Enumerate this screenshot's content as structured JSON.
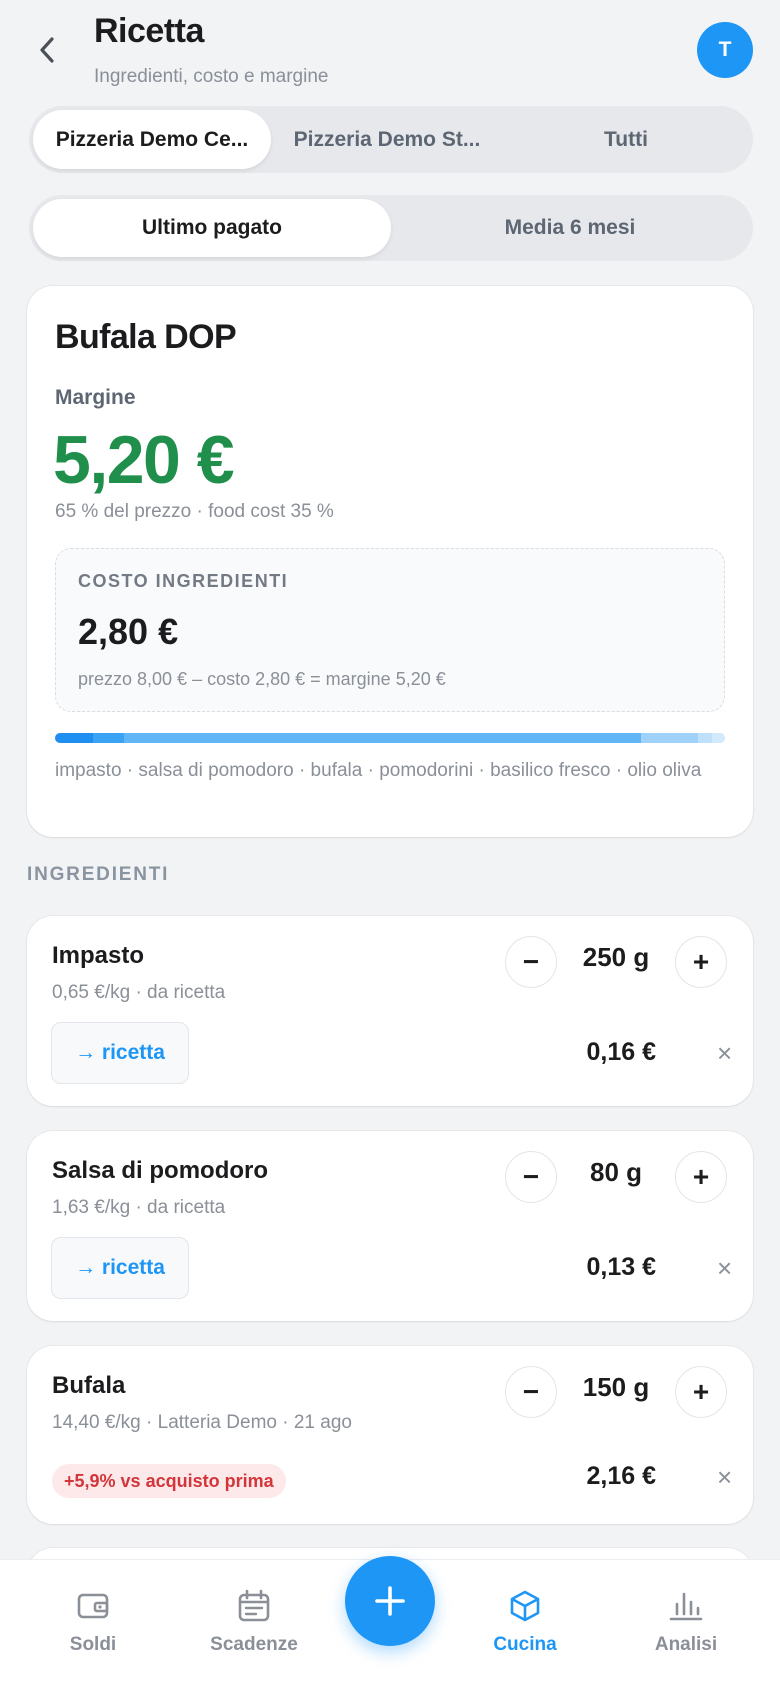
{
  "header": {
    "title": "Ricetta",
    "subtitle": "Ingredienti, costo e margine",
    "avatar_initial": "T"
  },
  "locations": {
    "tabs": [
      "Pizzeria Demo Ce...",
      "Pizzeria Demo St...",
      "Tutti"
    ],
    "selected": "Pizzeria Demo Ce..."
  },
  "price_mode": {
    "tabs": [
      "Ultimo pagato",
      "Media 6 mesi"
    ],
    "selected": "Ultimo pagato"
  },
  "summary": {
    "recipe_name": "Bufala DOP",
    "margin_label": "Margine",
    "margin_value": "5,20 €",
    "margin_sub": "65 % del prezzo · food cost 35 %",
    "cost_label": "COSTO INGREDIENTI",
    "cost_value": "2,80 €",
    "cost_formula": "prezzo 8,00 € – costo 2,80 € = margine 5,20 €",
    "cost_breakdown": [
      {
        "name": "impasto",
        "share": 0.057,
        "color": "#1e8ff0"
      },
      {
        "name": "salsa di pomodoro",
        "share": 0.046,
        "color": "#3aa3f4"
      },
      {
        "name": "bufala",
        "share": 0.771,
        "color": "#60b6f7"
      },
      {
        "name": "pomodorini",
        "share": 0.086,
        "color": "#9fd2fa"
      },
      {
        "name": "basilico fresco",
        "share": 0.02,
        "color": "#bfe0fb"
      },
      {
        "name": "olio oliva",
        "share": 0.02,
        "color": "#d3eafc"
      }
    ],
    "ingredients_text": "impasto · salsa di pomodoro · bufala · pomodorini · basilico fresco · olio oliva"
  },
  "ingredients_section": {
    "label": "INGREDIENTI",
    "items": [
      {
        "name": "Impasto",
        "meta": "0,65 €/kg · da ricetta",
        "qty": "250 g",
        "price": "0,16 €",
        "link": "→ ricetta"
      },
      {
        "name": "Salsa di pomodoro",
        "meta": "1,63 €/kg · da ricetta",
        "qty": "80 g",
        "price": "0,13 €",
        "link": "→ ricetta"
      },
      {
        "name": "Bufala",
        "meta": "14,40 €/kg · Latteria Demo · 21 ago",
        "qty": "150 g",
        "price": "2,16 €",
        "badge": "+5,9% vs acquisto prima"
      }
    ],
    "minus": "−",
    "plus": "+",
    "remove": "×"
  },
  "nav": {
    "items": [
      {
        "label": "Soldi",
        "icon": "wallet-icon"
      },
      {
        "label": "Scadenze",
        "icon": "calendar-icon"
      },
      {
        "label": "Cucina",
        "icon": "box-icon",
        "active": true
      },
      {
        "label": "Analisi",
        "icon": "bar-chart-icon"
      }
    ],
    "fab_icon": "plus-icon"
  },
  "colors": {
    "accent": "#1e96f5",
    "margin_green": "#1f8f4b",
    "badge_red": "#d2353a"
  }
}
